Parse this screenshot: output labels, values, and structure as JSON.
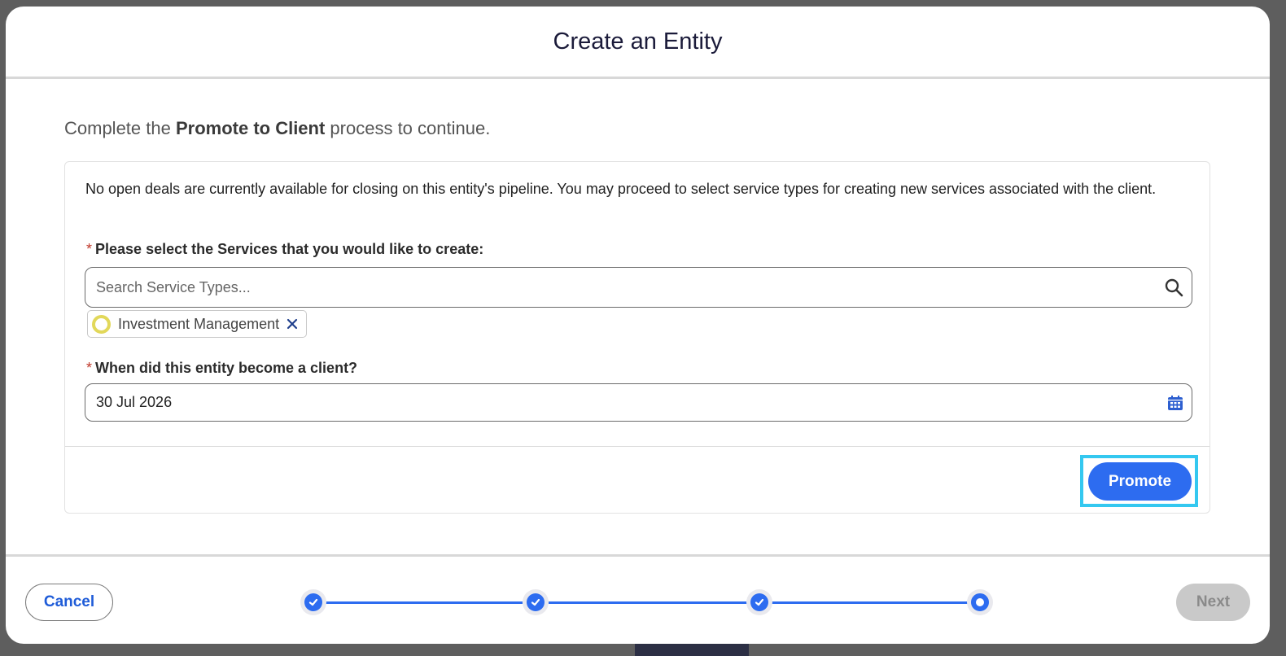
{
  "modal": {
    "title": "Create an Entity"
  },
  "intro": {
    "prefix": "Complete the ",
    "bold": "Promote to Client",
    "suffix": " process to continue."
  },
  "card": {
    "notice": "No open deals are currently available for closing on this entity's pipeline. You may proceed to select service types for creating new services associated with the client.",
    "services_field": {
      "required_mark": "*",
      "label": "Please select the Services that you would like to create:",
      "placeholder": "Search Service Types...",
      "icon": "search-icon"
    },
    "selected_services": [
      {
        "label": "Investment Management",
        "icon": "service-type-icon",
        "remove_icon": "close-icon"
      }
    ],
    "client_date_field": {
      "required_mark": "*",
      "label": "When did this entity become a client?",
      "value": "30 Jul 2026",
      "icon": "calendar-icon"
    },
    "promote_label": "Promote"
  },
  "footer": {
    "cancel_label": "Cancel",
    "next_label": "Next",
    "steps": [
      {
        "state": "complete"
      },
      {
        "state": "complete"
      },
      {
        "state": "complete"
      },
      {
        "state": "current"
      }
    ]
  },
  "colors": {
    "accent": "#2d6cf0",
    "focus_ring": "#34c8f0",
    "required": "#c0392b",
    "disabled": "#c9c9c9",
    "pill_icon": "#e2d85a"
  }
}
